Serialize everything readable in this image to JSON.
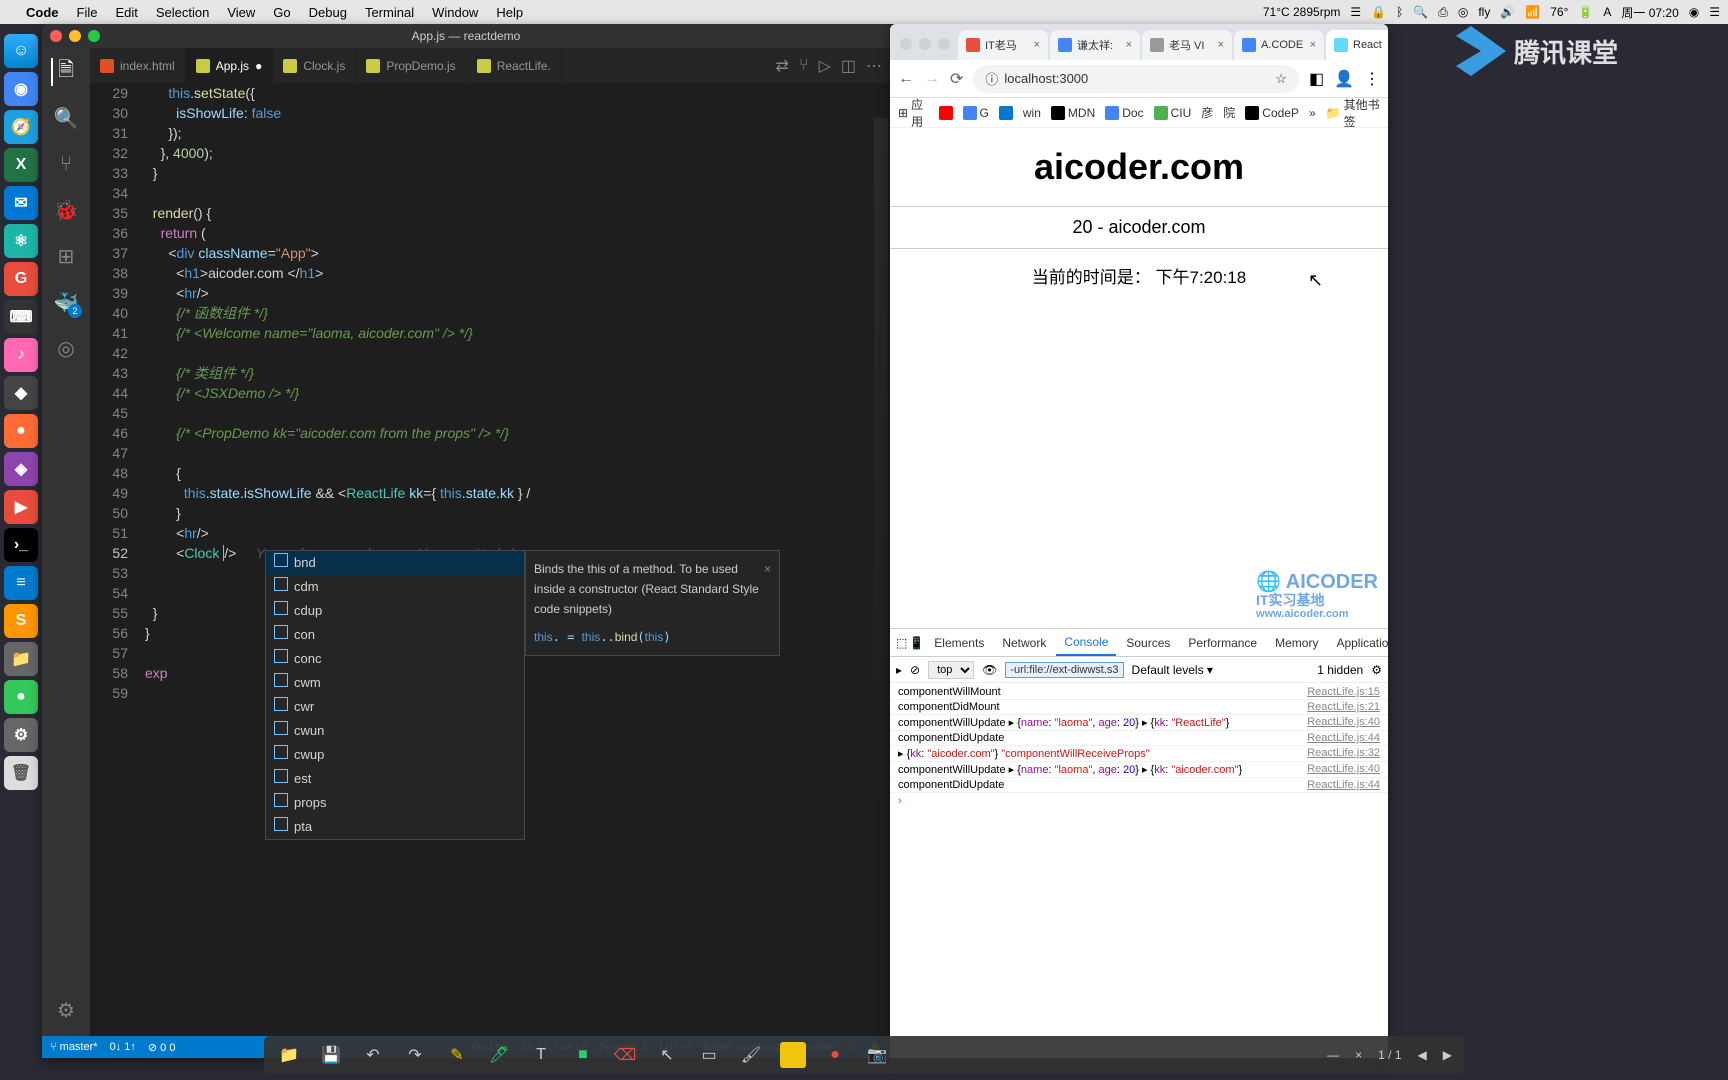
{
  "menubar": {
    "app": "Code",
    "items": [
      "File",
      "Edit",
      "Selection",
      "View",
      "Go",
      "Debug",
      "Terminal",
      "Window",
      "Help"
    ],
    "right": {
      "temp": "71°C 2895rpm",
      "temp2": "76°",
      "fly": "fly",
      "clock": "周一 07:20"
    }
  },
  "vscode": {
    "title": "App.js — reactdemo",
    "tabs": [
      {
        "icon": "html",
        "label": "index.html",
        "active": false
      },
      {
        "icon": "js",
        "label": "App.js",
        "active": true,
        "dirty": true
      },
      {
        "icon": "js",
        "label": "Clock.js",
        "active": false
      },
      {
        "icon": "js",
        "label": "PropDemo.js",
        "active": false
      },
      {
        "icon": "js",
        "label": "ReactLife.",
        "active": false
      }
    ],
    "line_start": 29,
    "inline_blame": "You, a few seconds ago • Uncommitted changes",
    "autocomplete": [
      "bnd",
      "cdm",
      "cdup",
      "con",
      "conc",
      "cwm",
      "cwr",
      "cwun",
      "cwup",
      "est",
      "props",
      "pta"
    ],
    "ac_doc": {
      "desc": "Binds the this of a method. To be used inside a constructor (React Standard Style code snippets)",
      "sig": "this. = this..bind(this)"
    },
    "status": {
      "branch": "master*",
      "sync": "0↓ 1↑",
      "errors": "0  0",
      "live": "Go Live",
      "pos": "Ln 52, Col 16",
      "spaces": "Spaces: 2",
      "enc": "UTF-8",
      "lang": "Babel JavaScript",
      "prettier": "Prettier"
    }
  },
  "browser": {
    "tabs": [
      {
        "label": "IT老马",
        "active": false
      },
      {
        "label": "谦太祥:",
        "active": false
      },
      {
        "label": "老马 VI",
        "active": false
      },
      {
        "label": "A.CODE",
        "active": false
      },
      {
        "label": "React",
        "active": true
      }
    ],
    "url": "localhost:3000",
    "bookmarks": [
      "应用",
      "",
      "G",
      "",
      "win",
      "MDN",
      "Doc",
      "CIU",
      "彦",
      "院",
      "CodeP"
    ],
    "bookmarks_more": "其他书签",
    "page": {
      "h1": "aicoder.com",
      "sub": "20 - aicoder.com",
      "time_label": "当前的时间是：",
      "time_value": "下午7:20:18"
    },
    "watermark": {
      "line1": "AICODER",
      "line2": "IT实习基地",
      "line3": "www.aicoder.com"
    }
  },
  "devtools": {
    "tabs": [
      "Elements",
      "Network",
      "Console",
      "Sources",
      "Performance",
      "Memory",
      "Application"
    ],
    "active_tab": "Console",
    "context": "top",
    "filter": "-url:file://ext-diwwst.s3",
    "levels": "Default levels ▾",
    "hidden": "1 hidden",
    "logs": [
      {
        "msg": "componentWillMount",
        "src": "ReactLife.js:15"
      },
      {
        "msg": "componentDidMount",
        "src": "ReactLife.js:21"
      },
      {
        "msg_html": "componentWillUpdate ▸ <span class='pn'>{</span><span class='jkey'>name</span>: <span class='jstr'>\"laoma\"</span>, <span class='jkey'>age</span>: <span class='jnum'>20</span><span class='pn'>}</span> ▸ <span class='pn'>{</span><span class='jkey'>kk</span>: <span class='jstr'>\"ReactLife\"</span><span class='pn'>}</span>",
        "src": "ReactLife.js:40"
      },
      {
        "msg": "componentDidUpdate",
        "src": "ReactLife.js:44"
      },
      {
        "msg_html": "▸ <span class='pn'>{</span><span class='jkey'>kk</span>: <span class='jstr'>\"aicoder.com\"</span><span class='pn'>}</span> <span class='jstr'>\"componentWillReceiveProps\"</span>",
        "src": "ReactLife.js:32"
      },
      {
        "msg_html": "componentWillUpdate ▸ <span class='pn'>{</span><span class='jkey'>name</span>: <span class='jstr'>\"laoma\"</span>, <span class='jkey'>age</span>: <span class='jnum'>20</span><span class='pn'>}</span> ▸ <span class='pn'>{</span><span class='jkey'>kk</span>: <span class='jstr'>\"aicoder.com\"</span><span class='pn'>}</span>",
        "src": "ReactLife.js:40"
      },
      {
        "msg": "componentDidUpdate",
        "src": "ReactLife.js:44"
      }
    ]
  },
  "overlay_wm": "腾讯课堂",
  "bottom_bar": {
    "counter": "1 / 1"
  }
}
